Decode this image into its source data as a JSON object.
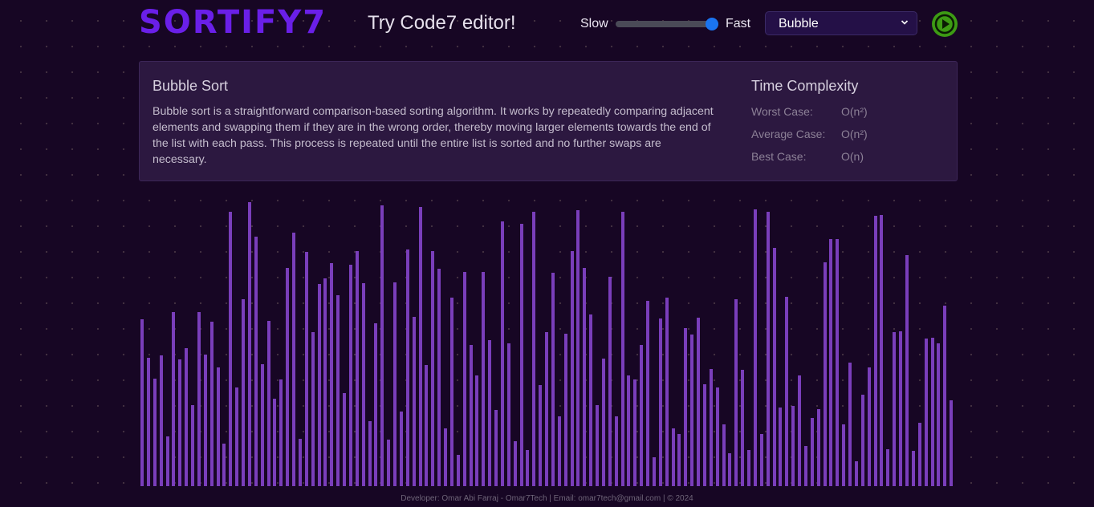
{
  "header": {
    "logo": "SORTIFY7",
    "try_link": "Try Code7 editor!",
    "speed_slow": "Slow",
    "speed_fast": "Fast",
    "speed_value": 1.0,
    "algorithm_selected": "Bubble",
    "play_icon": "play-icon"
  },
  "info": {
    "title": "Bubble Sort",
    "description": "Bubble sort is a straightforward comparison-based sorting algorithm. It works by repeatedly comparing adjacent elements and swapping them if they are in the wrong order, thereby moving larger elements towards the end of the list with each pass. This process is repeated until the entire list is sorted and no further swaps are necessary.",
    "complexity_title": "Time Complexity",
    "worst_label": "Worst Case:",
    "worst_value": "O(n²)",
    "average_label": "Average Case:",
    "average_value": "O(n²)",
    "best_label": "Best Case:",
    "best_value": "O(n)"
  },
  "array": {
    "max": 300,
    "values": [
      175,
      135,
      113,
      137,
      52,
      183,
      133,
      145,
      85,
      183,
      138,
      173,
      125,
      45,
      288,
      104,
      196,
      298,
      262,
      128,
      174,
      92,
      112,
      229,
      266,
      50,
      246,
      162,
      212,
      218,
      234,
      201,
      98,
      233,
      247,
      213,
      68,
      171,
      295,
      49,
      214,
      78,
      249,
      178,
      293,
      127,
      247,
      228,
      61,
      198,
      33,
      225,
      148,
      116,
      225,
      153,
      80,
      278,
      150,
      47,
      276,
      38,
      288,
      106,
      162,
      224,
      73,
      160,
      247,
      290,
      229,
      180,
      85,
      134,
      220,
      73,
      288,
      116,
      112,
      148,
      195,
      30,
      176,
      198,
      61,
      55,
      166,
      159,
      177,
      107,
      123,
      104,
      65,
      35,
      196,
      122,
      38,
      291,
      55,
      288,
      250,
      83,
      199,
      84,
      116,
      42,
      72,
      81,
      235,
      260,
      260,
      65,
      130,
      26,
      96,
      125,
      284,
      285,
      39,
      162,
      163,
      243,
      37,
      67,
      155,
      156,
      150,
      190,
      90
    ]
  },
  "footer": {
    "text": "Developer: Omar Abi Farraj - Omar7Tech | Email: omar7tech@gmail.com | © 2024"
  },
  "colors": {
    "background": "#170624",
    "logo": "#6a1fe8",
    "bar": "#7a3ebb",
    "play_button": "#3d9b14",
    "slider_thumb": "#1a74f0"
  }
}
